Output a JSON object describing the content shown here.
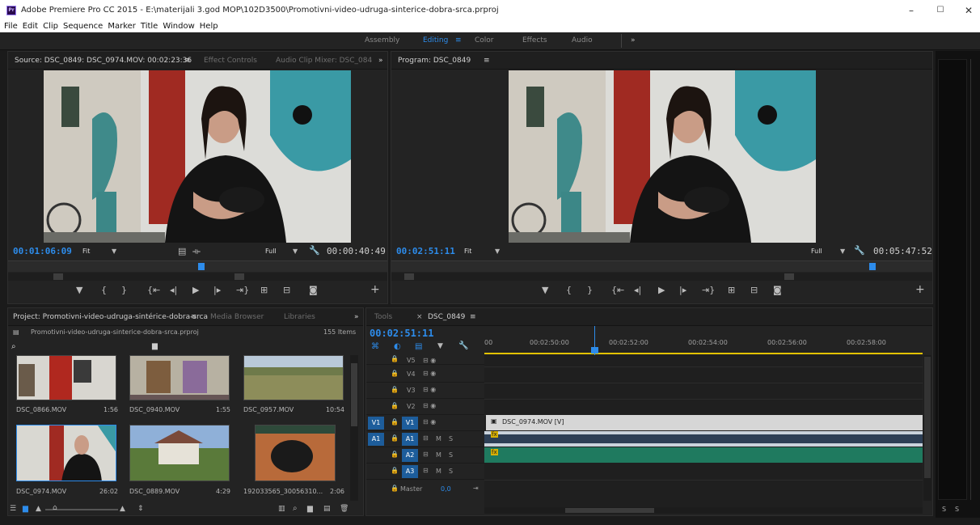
{
  "window": {
    "app_icon": "Pr",
    "title": "Adobe Premiere Pro CC 2015 - E:\\materijali 3.god MOP\\102D3500\\Promotivni-video-udruga-sinterice-dobra-srca.prproj",
    "min": "–",
    "max": "☐",
    "close": "✕"
  },
  "menu": [
    "File",
    "Edit",
    "Clip",
    "Sequence",
    "Marker",
    "Title",
    "Window",
    "Help"
  ],
  "workspaces": {
    "items": [
      "Assembly",
      "Editing",
      "Color",
      "Effects",
      "Audio"
    ],
    "active": "Editing",
    "more": "»",
    "menu_icon": "≡"
  },
  "source": {
    "tabs": [
      "Source: DSC_0849: DSC_0974.MOV: 00:02:23:36",
      "Effect Controls",
      "Audio Clip Mixer: DSC_084"
    ],
    "menu_icon": "≡",
    "more": "»",
    "timecode": "00:01:06:09",
    "fit": "Fit",
    "quality": "Full",
    "duration": "00:00:40:49",
    "playhead_fraction": 0.51
  },
  "program": {
    "tab": "Program: DSC_0849",
    "menu_icon": "≡",
    "timecode": "00:02:51:11",
    "fit": "Fit",
    "quality": "Full",
    "duration": "00:05:47:52",
    "playhead_fraction": 0.89
  },
  "transport_icons": [
    "marker-icon",
    "mark-in-icon",
    "mark-out-icon",
    "go-to-in-icon",
    "step-back-icon",
    "play-icon",
    "step-forward-icon",
    "go-to-out-icon",
    "insert-icon",
    "overwrite-icon",
    "export-frame-icon"
  ],
  "add_button": "+",
  "project": {
    "tabs": [
      "Project: Promotivni-video-udruga-sintérice-dobra-srca",
      "Media Browser",
      "Libraries"
    ],
    "menu_icon": "≡",
    "more": "»",
    "filename": "Promotivni-video-udruga-sinterice-dobra-srca.prproj",
    "count": "155 Items",
    "items": [
      {
        "name": "DSC_0866.MOV",
        "duration": "1:56"
      },
      {
        "name": "DSC_0940.MOV",
        "duration": "1:55"
      },
      {
        "name": "DSC_0957.MOV",
        "duration": "10:54"
      },
      {
        "name": "DSC_0974.MOV",
        "duration": "26:02"
      },
      {
        "name": "DSC_0889.MOV",
        "duration": "4:29"
      },
      {
        "name": "192033565_30056310...",
        "duration": "2:06"
      }
    ]
  },
  "timeline": {
    "tabs": [
      "Tools",
      "DSC_0849"
    ],
    "close": "×",
    "menu_icon": "≡",
    "timecode": "00:02:51:11",
    "ruler": [
      "00",
      "00:02:50:00",
      "00:02:52:00",
      "00:02:54:00",
      "00:02:56:00",
      "00:02:58:00"
    ],
    "tracks": [
      {
        "name": "V5",
        "src": ""
      },
      {
        "name": "V4",
        "src": ""
      },
      {
        "name": "V3",
        "src": ""
      },
      {
        "name": "V2",
        "src": ""
      },
      {
        "name": "V1",
        "src": "V1"
      },
      {
        "name": "A1",
        "src": "A1"
      },
      {
        "name": "A2",
        "src": ""
      },
      {
        "name": "A3",
        "src": ""
      }
    ],
    "master": {
      "label": "Master",
      "value": "0,0"
    },
    "clip_label": "DSC_0974.MOV [V]",
    "audio_badge": "fx",
    "track_buttons": {
      "mute": "M",
      "solo": "S"
    }
  },
  "meter_labels": [
    "S",
    "S"
  ],
  "colors": {
    "accent": "#2d8ceb",
    "audio_clip": "#1f7a5f",
    "panel": "#232323"
  }
}
